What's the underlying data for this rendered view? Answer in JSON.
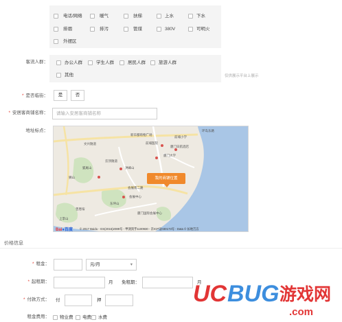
{
  "facilities": {
    "options": [
      "电话/网络",
      "暖气",
      "扶梯",
      "上水",
      "下水",
      "排烟",
      "排污",
      "管煤",
      "380V",
      "可明火",
      "外摆区"
    ]
  },
  "customers": {
    "label": "客流人群：",
    "options": [
      "办公人群",
      "学生人群",
      "居民人群",
      "旅游人群",
      "其他"
    ],
    "hint": "仅供展示平台上展示"
  },
  "transfer": {
    "label": "是否临街：",
    "yes": "是",
    "no": "否"
  },
  "shop_name": {
    "label": "安居客商铺名称：",
    "placeholder": "请输入安居客商铺名称"
  },
  "map": {
    "label": "地址标点：",
    "marker_label": "我的商铺位置",
    "copyright": "© 2017 Baidu - GS(2016)2089号 - 甲测资字1100930 - 京ICP证030173号 - Data © 长地万方",
    "logo_bai": "Bai",
    "logo_du": "百度",
    "places": [
      "文兴隧道",
      "新华都购物广场",
      "前埔小学",
      "前埔医院",
      "厦门日航酒店",
      "厦门大学",
      "云顶隧道",
      "洪峰山",
      "狮山",
      "会展南二路",
      "会展中心",
      "上李山",
      "曾厝垵",
      "东坪山",
      "狐尾山",
      "环岛东路",
      "厦门国际会展中心"
    ]
  },
  "price_section": {
    "title": "价格信息"
  },
  "rent": {
    "label": "租金：",
    "unit": "元/月"
  },
  "lease": {
    "label": "起租期：",
    "unit": "月",
    "free_label": "免租期：",
    "free_unit": "月"
  },
  "payment": {
    "label": "付款方式：",
    "pay": "付",
    "deposit": "押"
  },
  "fees": {
    "label": "租金费用：",
    "options": [
      "物业费",
      "电费",
      "水费"
    ]
  },
  "watermark": {
    "uc": "UC",
    "bug": "BUG",
    "cn": "游戏网",
    "com": ".com"
  },
  "colors": {
    "required": "#e3392d",
    "marker": "#f0892b",
    "sea": "#a9c6e6",
    "land": "#eeeae2",
    "watermark": "#e23535"
  }
}
